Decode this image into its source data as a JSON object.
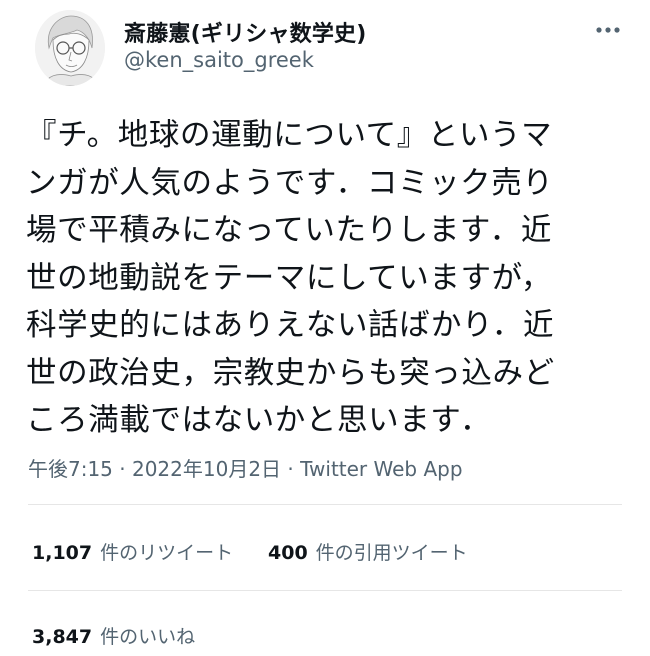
{
  "user": {
    "display_name": "斎藤憲(ギリシャ数学史)",
    "handle": "@ken_saito_greek"
  },
  "icons": {
    "avatar": "avatar",
    "more": "more-horizontal-icon"
  },
  "tweet": {
    "text": "『チ。地球の運動について』というマ\nンガが人気のようです．コミック売り\n場で平積みになっていたりします．近\n世の地動説をテーマにしていますが，\n科学史的にはありえない話ばかり．近\n世の政治史，宗教史からも突っ込みど\nころ満載ではないかと思います．"
  },
  "meta": {
    "text": "午後7:15 · 2022年10月2日 · Twitter Web App"
  },
  "stats": {
    "retweets_count": "1,107",
    "retweets_label": "件のリツイート",
    "quotes_count": "400",
    "quotes_label": "件の引用ツイート",
    "likes_count": "3,847",
    "likes_label": "件のいいね"
  },
  "colors": {
    "text": "#0f1419",
    "secondary": "#536471",
    "divider": "#e6e6e6"
  }
}
